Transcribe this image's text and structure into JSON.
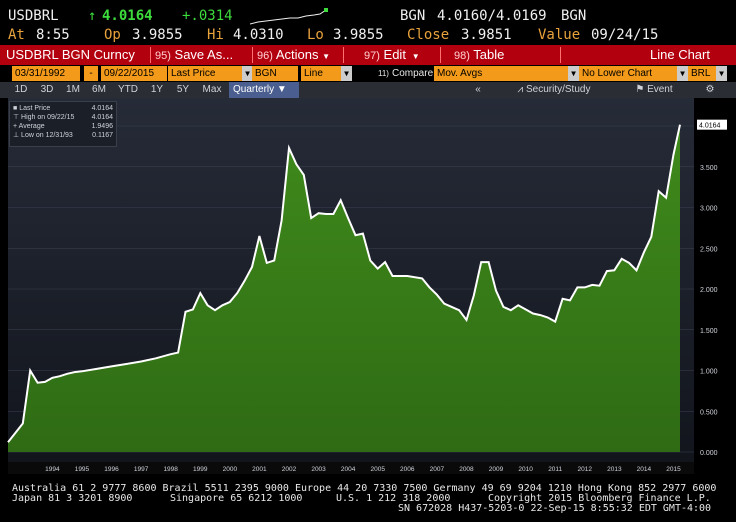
{
  "header": {
    "ticker": "USDBRL",
    "arrow": "↑",
    "last": "4.0164",
    "change": "+.0314",
    "bid_ask_label": "BGN",
    "bid_ask": "4.0160/4.0169",
    "bid_ask_src": "BGN",
    "at_label": "At",
    "at_value": "8:55",
    "open_label": "Op",
    "open_value": "3.9855",
    "high_label": "Hi",
    "high_value": "4.0310",
    "low_label": "Lo",
    "low_value": "3.9855",
    "close_label": "Close",
    "close_value": "3.9851",
    "value_label": "Value",
    "value_date": "09/24/15"
  },
  "menubar": {
    "security": "USDBRL BGN Curncy",
    "save_num": "95)",
    "save": "Save As...",
    "actions_num": "96)",
    "actions": "Actions",
    "edit_num": "97)",
    "edit": "Edit",
    "table_num": "98)",
    "table": "Table",
    "chart_type": "Line Chart"
  },
  "params": {
    "start": "03/31/1992",
    "dash": "-",
    "end": "09/22/2015",
    "field": "Last Price",
    "source": "BGN",
    "style": "Line",
    "compare_num": "11)",
    "compare": "Compare",
    "compare_sel": "Mov. Avgs",
    "lower": "No Lower Chart",
    "currency": "BRL"
  },
  "toolbar": {
    "ranges": [
      "1D",
      "3D",
      "1M",
      "6M",
      "YTD",
      "1Y",
      "5Y",
      "Max"
    ],
    "period": "Quarterly",
    "collapse": "«",
    "study": "Security/Study",
    "event": "Event",
    "gear_icon": "gear-icon"
  },
  "legend": {
    "last_label": "Last Price",
    "last_value": "4.0164",
    "high_label": "High on 09/22/15",
    "high_value": "4.0164",
    "avg_label": "Average",
    "avg_value": "1.9496",
    "low_label": "Low on 12/31/93",
    "low_value": "0.1167"
  },
  "chart_data": {
    "type": "area",
    "x_ticks": [
      "1994",
      "1995",
      "1996",
      "1997",
      "1998",
      "1999",
      "2000",
      "2001",
      "2002",
      "2003",
      "2004",
      "2005",
      "2006",
      "2007",
      "2008",
      "2009",
      "2010",
      "2011",
      "2012",
      "2013",
      "2014",
      "2015"
    ],
    "y_ticks": [
      "0.000",
      "0.500",
      "1.000",
      "1.500",
      "2.000",
      "2.500",
      "3.000",
      "3.500",
      "4.000"
    ],
    "ylim": [
      0,
      4.2
    ],
    "last_label": "4.0164",
    "x": [
      1993.0,
      1993.5,
      1993.75,
      1994.0,
      1994.25,
      1994.5,
      1994.75,
      1995.0,
      1995.25,
      1995.5,
      1996.0,
      1996.5,
      1997.0,
      1997.5,
      1998.0,
      1998.5,
      1998.75,
      1999.0,
      1999.25,
      1999.5,
      1999.75,
      2000.0,
      2000.25,
      2000.5,
      2000.75,
      2001.0,
      2001.25,
      2001.5,
      2001.75,
      2002.0,
      2002.25,
      2002.5,
      2002.75,
      2003.0,
      2003.25,
      2003.5,
      2003.75,
      2004.0,
      2004.25,
      2004.5,
      2004.75,
      2005.0,
      2005.25,
      2005.5,
      2005.75,
      2006.0,
      2006.5,
      2007.0,
      2007.25,
      2007.5,
      2007.75,
      2008.0,
      2008.25,
      2008.5,
      2008.75,
      2009.0,
      2009.25,
      2009.5,
      2009.75,
      2010.0,
      2010.25,
      2010.5,
      2010.75,
      2011.0,
      2011.25,
      2011.5,
      2011.75,
      2012.0,
      2012.25,
      2012.5,
      2012.75,
      2013.0,
      2013.25,
      2013.5,
      2013.75,
      2014.0,
      2014.25,
      2014.5,
      2014.75,
      2015.0,
      2015.25,
      2015.5,
      2015.72
    ],
    "y": [
      0.12,
      0.35,
      1.0,
      0.85,
      0.86,
      0.91,
      0.93,
      0.96,
      0.98,
      0.99,
      1.02,
      1.05,
      1.08,
      1.11,
      1.15,
      1.2,
      1.22,
      1.72,
      1.75,
      1.95,
      1.8,
      1.74,
      1.8,
      1.84,
      1.95,
      2.1,
      2.27,
      2.65,
      2.32,
      2.35,
      2.84,
      3.73,
      3.53,
      3.4,
      2.87,
      2.93,
      2.92,
      2.92,
      3.09,
      2.87,
      2.66,
      2.68,
      2.35,
      2.25,
      2.33,
      2.16,
      2.16,
      2.13,
      2.02,
      1.93,
      1.82,
      1.78,
      1.74,
      1.62,
      1.92,
      2.33,
      2.33,
      1.98,
      1.78,
      1.74,
      1.8,
      1.75,
      1.7,
      1.68,
      1.65,
      1.6,
      1.88,
      1.86,
      2.02,
      2.02,
      2.05,
      2.04,
      2.22,
      2.23,
      2.37,
      2.32,
      2.23,
      2.45,
      2.64,
      3.2,
      3.12,
      3.65,
      4.0164
    ]
  },
  "footer": {
    "line1": "Australia 61 2 9777 8600 Brazil 5511 2395 9000 Europe 44 20 7330 7500 Germany 49 69 9204 1210 Hong Kong 852 2977 6000",
    "line2a": "Japan 81 3 3201 8900",
    "line2b": "Singapore 65 6212 1000",
    "line2c": "U.S. 1 212 318 2000",
    "line2d": "Copyright 2015 Bloomberg Finance L.P.",
    "line3": "SN 672028 H437-5203-0 22-Sep-15   8:55:32 EDT  GMT-4:00"
  }
}
